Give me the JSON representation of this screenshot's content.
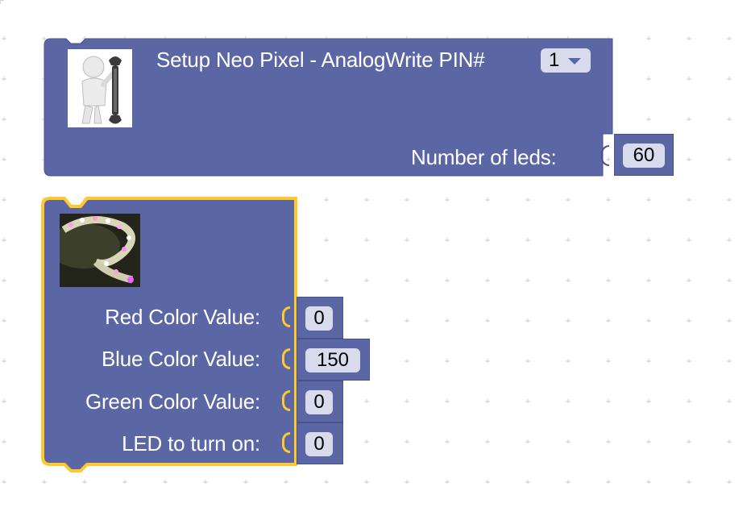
{
  "setup_block": {
    "title": "Setup Neo Pixel - AnalogWrite PIN#",
    "pin_value": "1",
    "icon": "wrench-man-icon",
    "leds_label": "Number of leds:",
    "leds_value": "60"
  },
  "color_block": {
    "icon": "led-strip-image",
    "rows": [
      {
        "label": "Red Color Value:",
        "value": "0"
      },
      {
        "label": "Blue Color Value:",
        "value": "150"
      },
      {
        "label": "Green Color Value:",
        "value": "0"
      },
      {
        "label": "LED to turn on:",
        "value": "0"
      }
    ]
  },
  "colors": {
    "block": "#5b67a5",
    "block_border": "#48528a",
    "selected_outline": "#ffc82c",
    "field_bg": "#d7dbec",
    "grid_dot": "#cfcfcf"
  }
}
